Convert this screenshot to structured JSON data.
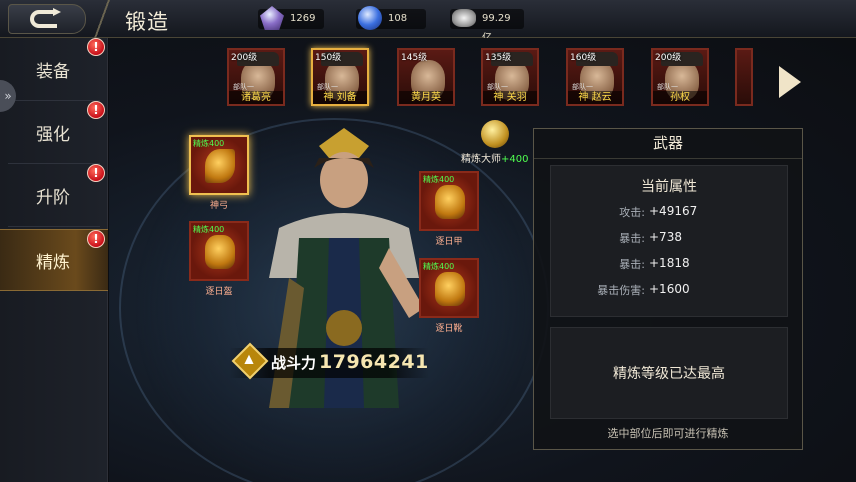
{
  "header": {
    "title": "锻造",
    "resources": [
      {
        "icon": "purple-gem-icon",
        "value": "1269"
      },
      {
        "icon": "blue-gem-icon",
        "value": "108"
      },
      {
        "icon": "silver-coin-icon",
        "value": "99.29亿"
      }
    ]
  },
  "sidebar": {
    "items": [
      {
        "label": "装备",
        "badge": "!"
      },
      {
        "label": "强化",
        "badge": "!"
      },
      {
        "label": "升阶",
        "badge": "!"
      },
      {
        "label": "精炼",
        "badge": "!"
      }
    ],
    "active_index": 3
  },
  "heroes": [
    {
      "level": "200级",
      "tag": "部队一",
      "name": "诸葛亮"
    },
    {
      "level": "150级",
      "tag": "部队一",
      "name": "神 刘备"
    },
    {
      "level": "145级",
      "tag": "",
      "name": "黄月英"
    },
    {
      "level": "135级",
      "tag": "部队一",
      "name": "神 关羽"
    },
    {
      "level": "160级",
      "tag": "部队一",
      "name": "神 赵云"
    },
    {
      "level": "200级",
      "tag": "部队一",
      "name": "孙权"
    }
  ],
  "selected_hero_index": 1,
  "equipment": [
    {
      "slot": "weapon",
      "level": "精炼400",
      "name": "神弓",
      "selected": true
    },
    {
      "slot": "helmet",
      "level": "精炼400",
      "name": "逐日盔",
      "selected": false
    },
    {
      "slot": "armor",
      "level": "精炼400",
      "name": "逐日甲",
      "selected": false
    },
    {
      "slot": "boots",
      "level": "精炼400",
      "name": "逐日靴",
      "selected": false
    }
  ],
  "master": {
    "label": "精炼大师",
    "bonus": "+400"
  },
  "power": {
    "label": "战斗力",
    "value": "17964241"
  },
  "panel": {
    "title": "武器",
    "current_attr_title": "当前属性",
    "attributes": [
      {
        "key": "攻击:",
        "value": "+49167"
      },
      {
        "key": "暴击:",
        "value": "+738"
      },
      {
        "key": "暴击:",
        "value": "+1818"
      },
      {
        "key": "暴击伤害:",
        "value": "+1600"
      }
    ],
    "max_text": "精炼等级已达最高",
    "hint": "选中部位后即可进行精炼"
  }
}
